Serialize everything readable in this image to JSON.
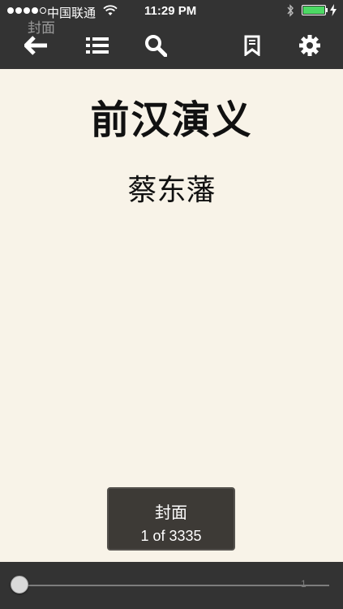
{
  "status_bar": {
    "carrier": "中国联通",
    "time": "11:29 PM"
  },
  "header": {
    "overlay_title": "封面"
  },
  "toolbar": {
    "icons": [
      "back-arrow-icon",
      "table-of-contents-icon",
      "search-icon",
      "bookmark-icon",
      "settings-gear-icon"
    ]
  },
  "book": {
    "title": "前汉演义",
    "author": "蔡东藩"
  },
  "page_toast": {
    "chapter": "封面",
    "page_info": "1 of 3335"
  },
  "slider": {
    "tick_label": "1",
    "position": 1,
    "total": 3335
  },
  "colors": {
    "toolbar_bg": "#333333",
    "page_bg": "#f8f3e8",
    "battery": "#4cd964"
  }
}
